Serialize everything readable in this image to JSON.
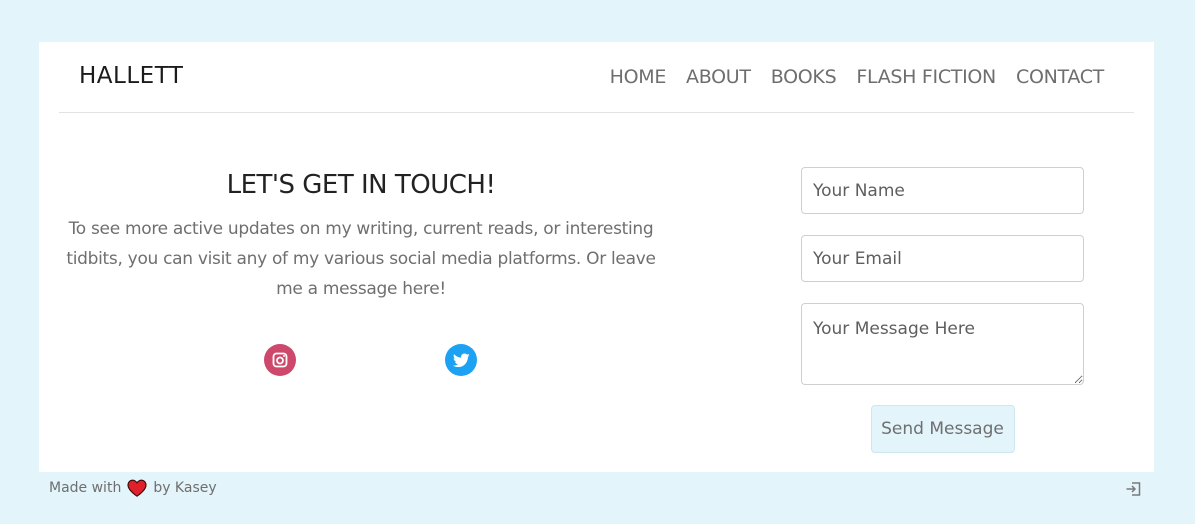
{
  "brand": {
    "name": "HALLETT"
  },
  "nav": {
    "items": [
      {
        "label": "HOME"
      },
      {
        "label": "ABOUT"
      },
      {
        "label": "BOOKS"
      },
      {
        "label": "FLASH FICTION"
      },
      {
        "label": "CONTACT"
      }
    ]
  },
  "contact": {
    "heading": "LET'S GET IN TOUCH!",
    "blurb": "To see more active updates on my writing, current reads, or interesting tidbits, you can visit any of my various social media platforms. Or leave me a message here!",
    "social": [
      {
        "icon": "instagram-icon",
        "color": "#cd486b"
      },
      {
        "icon": "twitter-icon",
        "color": "#1da1f2"
      }
    ]
  },
  "form": {
    "name_placeholder": "Your Name",
    "email_placeholder": "Your Email",
    "message_placeholder": "Your Message Here",
    "submit_label": "Send Message"
  },
  "footer": {
    "made_with": "Made with",
    "by": "by Kasey",
    "heart_icon": "heart-icon",
    "login_icon": "sign-in-icon"
  },
  "colors": {
    "page_background": "#e3f4fb",
    "card_background": "#ffffff",
    "button_background": "#e3f4fb"
  }
}
